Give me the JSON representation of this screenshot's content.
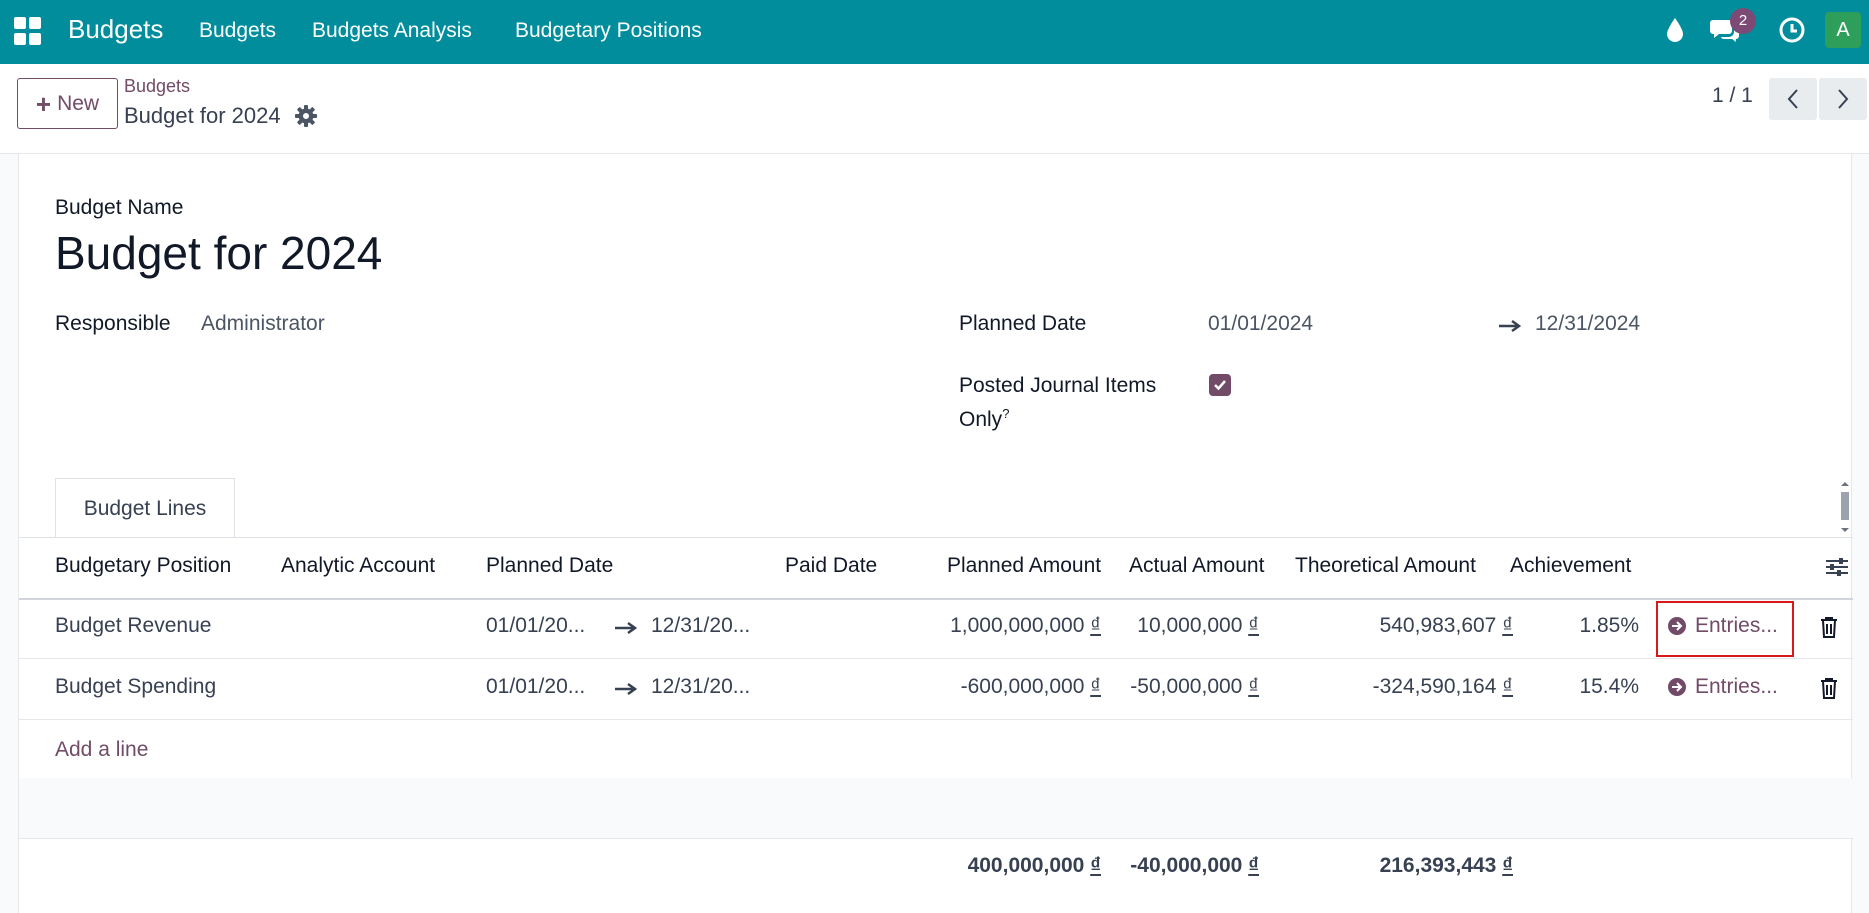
{
  "navbar": {
    "brand": "Budgets",
    "links": [
      "Budgets",
      "Budgets Analysis",
      "Budgetary Positions"
    ],
    "message_count": "2",
    "avatar_letter": "A",
    "bg_color": "#018d9c"
  },
  "control": {
    "new_label": "New",
    "breadcrumb_parent": "Budgets",
    "breadcrumb_current": "Budget for 2024",
    "pager": "1 / 1"
  },
  "form": {
    "name_label": "Budget Name",
    "name_value": "Budget for 2024",
    "responsible_label": "Responsible",
    "responsible_value": "Administrator",
    "planned_date_label": "Planned Date",
    "planned_date_from": "01/01/2024",
    "planned_date_to": "12/31/2024",
    "posted_label_line1": "Posted Journal Items",
    "posted_label_line2": "Only",
    "posted_help": "?",
    "posted_checked": true
  },
  "tabs": [
    "Budget Lines"
  ],
  "table": {
    "headers": [
      "Budgetary Position",
      "Analytic Account",
      "Planned Date",
      "Paid Date",
      "Planned Amount",
      "Actual Amount",
      "Theoretical Amount",
      "Achievement"
    ],
    "rows": [
      {
        "position": "Budget Revenue",
        "date_from": "01/01/20...",
        "date_to": "12/31/20...",
        "planned": "1,000,000,000",
        "actual": "10,000,000",
        "theoretical": "540,983,607",
        "achievement": "1.85%",
        "entries_label": "Entries..."
      },
      {
        "position": "Budget Spending",
        "date_from": "01/01/20...",
        "date_to": "12/31/20...",
        "planned": "-600,000,000",
        "actual": "-50,000,000",
        "theoretical": "-324,590,164",
        "achievement": "15.4%",
        "entries_label": "Entries..."
      }
    ],
    "currency": "₫",
    "add_line": "Add a line",
    "totals": {
      "planned": "400,000,000",
      "actual": "-40,000,000",
      "theoretical": "216,393,443"
    }
  }
}
